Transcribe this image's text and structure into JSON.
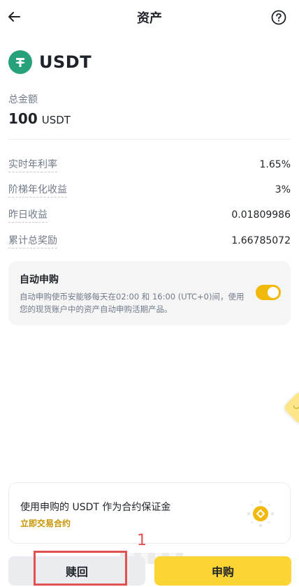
{
  "header": {
    "title": "资产",
    "back_icon": "arrow-left-icon",
    "help_icon": "question-circle-icon"
  },
  "asset": {
    "name": "USDT",
    "logo_icon": "tether-icon",
    "logo_color": "#26a17b"
  },
  "total": {
    "label": "总金额",
    "amount": "100",
    "unit": "USDT"
  },
  "stats": [
    {
      "label": "实时年利率",
      "value": "1.65%"
    },
    {
      "label": "阶梯年化收益",
      "value": "3%"
    },
    {
      "label": "昨日收益",
      "value": "0.01809986"
    },
    {
      "label": "累计总奖励",
      "value": "1.66785072"
    }
  ],
  "auto_subscribe": {
    "title": "自动申购",
    "description": "自动申购使币安能够每天在02:00 和 16:00 (UTC+0)间，使用您的现货账户中的资产自动申购活期产品。",
    "enabled": true,
    "toggle_color": "#f0b90b"
  },
  "promo": {
    "title": "使用申购的 USDT 作为合约保证金",
    "link": "立即交易合约",
    "link_color": "#c99400"
  },
  "annotation": {
    "number": "1",
    "color": "#e05252"
  },
  "actions": {
    "redeem_label": "赎回",
    "subscribe_label": "申购",
    "subscribe_color": "#fcd535"
  }
}
